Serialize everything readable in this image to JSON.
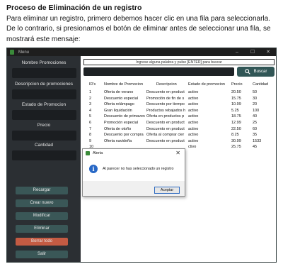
{
  "doc": {
    "heading": "Proceso de Eliminación de un registro",
    "paragraph": "Para eliminar un registro, primero debemos hacer clic en una fila para seleccionarla. De lo contrario, si presionamos el botón de eliminar antes de seleccionar una fila, se mostrará este mensaje:"
  },
  "window": {
    "title": "Menu",
    "controls": [
      "–",
      "☐",
      "✕"
    ]
  },
  "sidebar": {
    "labels": [
      "Nombre Promociones",
      "Descripcion de promociones",
      "Estado de Promocion",
      "Precio",
      "Cantidad"
    ],
    "buttons": [
      "Recargar",
      "Crear nuevo",
      "Modificar",
      "Eliminar",
      "Borrar todo",
      "Salir"
    ]
  },
  "search": {
    "hint": "Ingrese alguna palabra y pulse [ENTER] para buscar",
    "button_label": "Buscar",
    "button_icon": "search-icon"
  },
  "table": {
    "headers": [
      "ID's",
      "Nombre de Promocion",
      "Descripcion",
      "Estado de promocion",
      "Precio",
      "Cantidad"
    ],
    "rows": [
      [
        "1",
        "Oferta de verano",
        "Descuento en product",
        "activo",
        "20.50",
        "50"
      ],
      [
        "2",
        "Descuento especial",
        "Promoción de fin de s",
        "activo",
        "15.75",
        "30"
      ],
      [
        "3",
        "Oferta relámpago",
        "Descuento por tiempo",
        "activo",
        "10.99",
        "20"
      ],
      [
        "4",
        "Gran liquidación",
        "Productos rebajados h",
        "activo",
        "5.25",
        "100"
      ],
      [
        "5",
        "Descuento de primavera",
        "Oferta en productos p",
        "activo",
        "18.75",
        "40"
      ],
      [
        "6",
        "Promoción especial",
        "Descuento en product",
        "activo",
        "12.99",
        "25"
      ],
      [
        "7",
        "Oferta de otoño",
        "Descuento en product",
        "activo",
        "22.50",
        "60"
      ],
      [
        "8",
        "Descuento por compra",
        "Oferta al comprar cier",
        "activo",
        "8.25",
        "35"
      ],
      [
        "9",
        "Oferta navideña",
        "Descuento en product",
        "activo",
        "30.99",
        "1533"
      ],
      [
        "10",
        "",
        "",
        "ctivo",
        "25.75",
        "45"
      ]
    ]
  },
  "dialog": {
    "title": "Alerta",
    "message": "Al parecer no has seleccionado un registro",
    "ok_label": "Aceptar",
    "icon": "info-icon"
  },
  "colors": {
    "sidebar_bg": "#2b2f33",
    "button_teal": "#3a5757",
    "button_red": "#c45b43",
    "info_blue": "#2868c6"
  }
}
